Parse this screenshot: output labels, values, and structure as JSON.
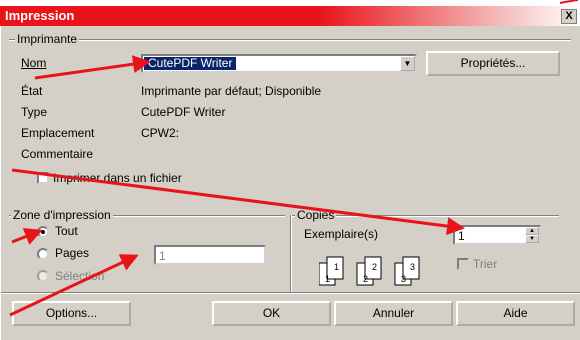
{
  "window": {
    "title": "Impression",
    "close_glyph": "X"
  },
  "printer": {
    "group_label": "Imprimante",
    "name_label": "Nom",
    "name_value": "CutePDF Writer",
    "properties_button": "Propriétés...",
    "status_label": "État",
    "status_value": "Imprimante par défaut; Disponible",
    "type_label": "Type",
    "type_value": "CutePDF Writer",
    "location_label": "Emplacement",
    "location_value": "CPW2:",
    "comment_label": "Commentaire",
    "print_to_file_label": "Imprimer dans un fichier"
  },
  "range": {
    "group_label": "Zone d'impression",
    "all_label": "Tout",
    "pages_label": "Pages",
    "pages_value": "1",
    "selection_label": "Sélection"
  },
  "copies": {
    "group_label": "Copies",
    "count_label": "Exemplaire(s)",
    "count_value": "1",
    "collate_label": "Trier",
    "icon_numbers": [
      "1",
      "1",
      "2",
      "2",
      "3",
      "3"
    ]
  },
  "buttons": {
    "options": "Options...",
    "ok": "OK",
    "cancel": "Annuler",
    "help": "Aide"
  },
  "colors": {
    "arrow": "#e8141a",
    "titlebar": "#e8141a",
    "dialog": "#d4d0c8"
  }
}
